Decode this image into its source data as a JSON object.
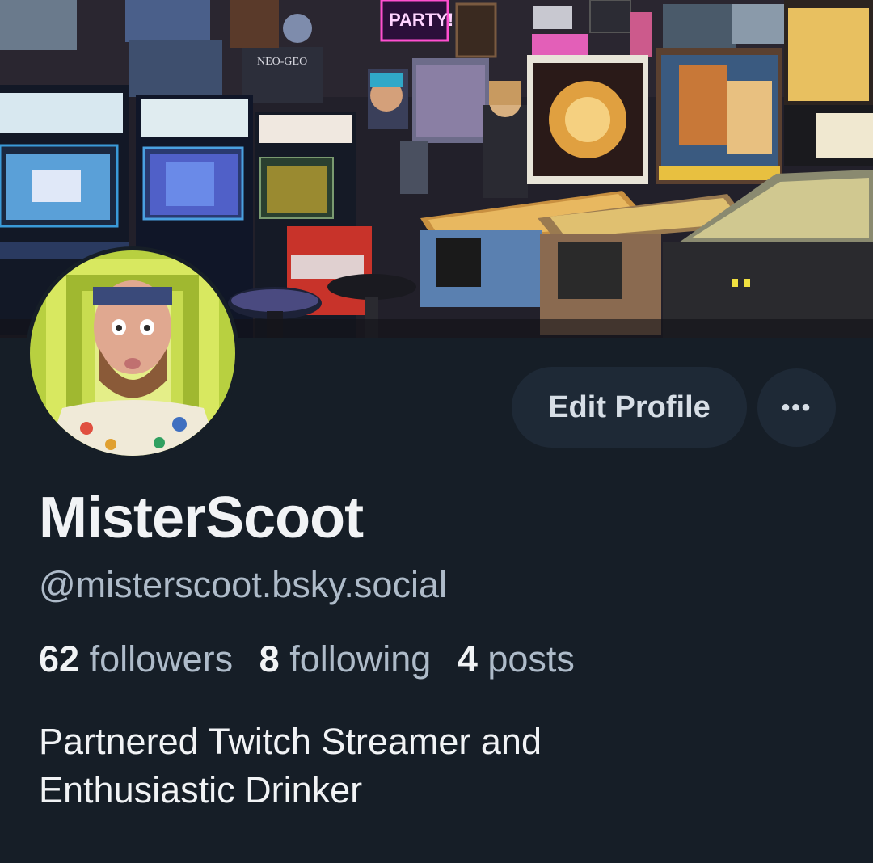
{
  "profile": {
    "display_name": "MisterScoot",
    "handle": "@misterscoot.bsky.social",
    "bio_line1": "Partnered Twitch Streamer and",
    "bio_line2": "Enthusiastic Drinker"
  },
  "stats": {
    "followers_count": "62",
    "followers_label": "followers",
    "following_count": "8",
    "following_label": "following",
    "posts_count": "4",
    "posts_label": "posts"
  },
  "actions": {
    "edit_profile_label": "Edit Profile",
    "more_label": "•••"
  },
  "banner": {
    "neon_sign_text": "PARTY!",
    "console_box_text": "NEO-GEO"
  },
  "colors": {
    "background": "#161e27",
    "button_bg": "#1e2936",
    "text_primary": "#f1f3f5",
    "text_secondary": "#aebbc9"
  }
}
